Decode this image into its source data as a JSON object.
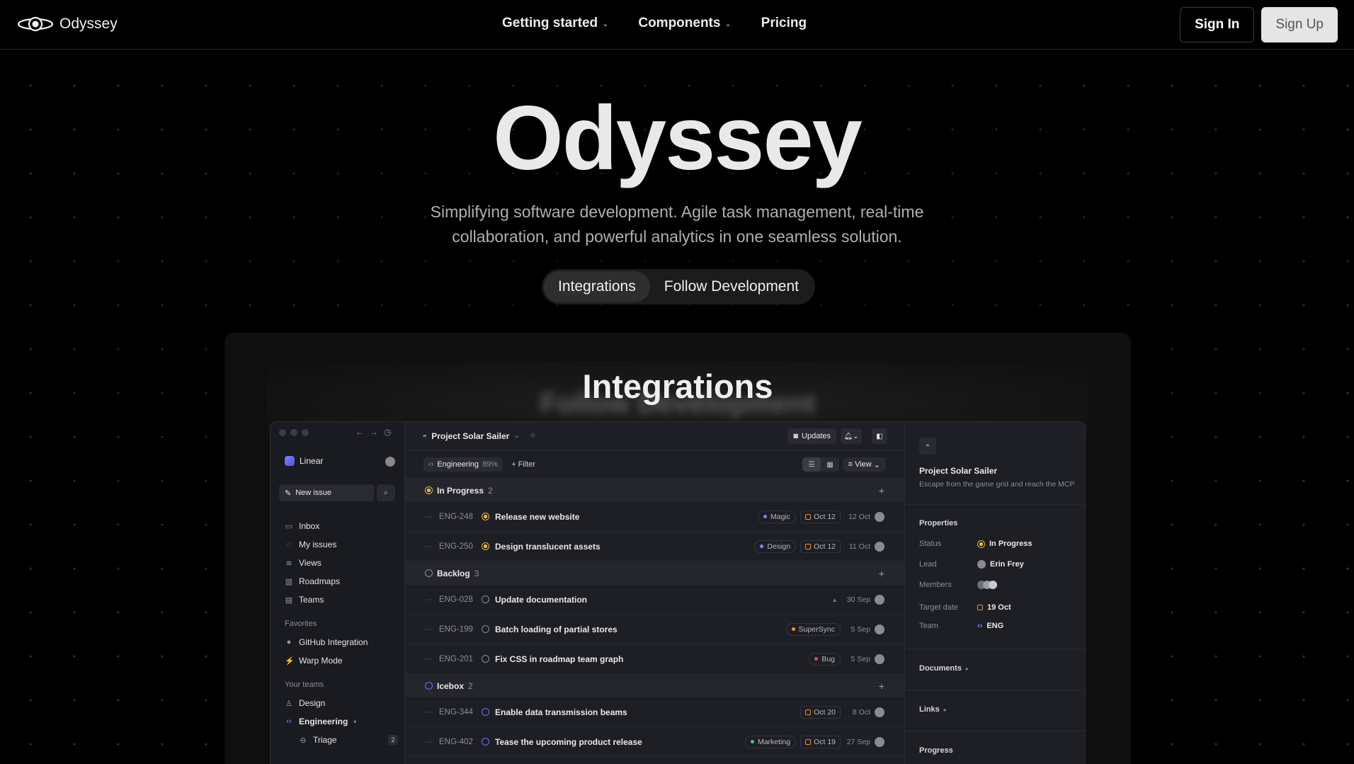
{
  "brand": {
    "name": "Odyssey",
    "logo_icon": "eye-planet-logo-icon"
  },
  "nav": {
    "links": [
      {
        "label": "Getting started",
        "has_dropdown": true
      },
      {
        "label": "Components",
        "has_dropdown": true
      },
      {
        "label": "Pricing",
        "has_dropdown": false
      }
    ],
    "sign_in": "Sign In",
    "sign_up": "Sign Up"
  },
  "hero": {
    "title": "Odyssey",
    "subtitle_line1": "Simplifying software development. Agile task management, real-time",
    "subtitle_line2": "collaboration, and powerful analytics in one seamless solution.",
    "tabs": [
      {
        "label": "Integrations",
        "active": true
      },
      {
        "label": "Follow Development",
        "active": false
      }
    ]
  },
  "showcase": {
    "title": "Integrations",
    "ghost_title": "Follow Development"
  },
  "app": {
    "workspace": "Linear",
    "new_issue": "New issue",
    "nav_items": [
      "Inbox",
      "My issues",
      "Views",
      "Roadmaps",
      "Teams"
    ],
    "favorites_label": "Favorites",
    "favorites": [
      "GitHub Integration",
      "Warp Mode"
    ],
    "teams_label": "Your teams",
    "teams": [
      {
        "label": "Design"
      },
      {
        "label": "Engineering",
        "suffix": "▾"
      },
      {
        "label": "Triage",
        "count": "2"
      }
    ],
    "project_title": "Project Solar Sailer",
    "updates": "Updates",
    "filter_chip": {
      "label": "Engineering",
      "pct": "89%"
    },
    "filter": "Filter",
    "view": "View",
    "groups": [
      {
        "label": "In Progress",
        "count": "2",
        "status": "progress",
        "issues": [
          {
            "id": "ENG-248",
            "title": "Release new website",
            "tag": "Magic",
            "tag_color": "#7c83ff",
            "due": "Oct 12",
            "date": "12 Oct"
          },
          {
            "id": "ENG-250",
            "title": "Design translucent assets",
            "tag": "Design",
            "tag_color": "#7c83ff",
            "due": "Oct 12",
            "date": "11 Oct"
          }
        ]
      },
      {
        "label": "Backlog",
        "count": "3",
        "status": "backlog",
        "issues": [
          {
            "id": "ENG-028",
            "title": "Update documentation",
            "tag": "",
            "tag_color": "",
            "due": "",
            "date": "30 Sep"
          },
          {
            "id": "ENG-199",
            "title": "Batch loading of partial stores",
            "tag": "SuperSync",
            "tag_color": "#e6923a",
            "due": "",
            "date": "5 Sep"
          },
          {
            "id": "ENG-201",
            "title": "Fix CSS in roadmap team graph",
            "tag": "Bug",
            "tag_color": "#e5484d",
            "due": "",
            "date": "5 Sep"
          }
        ]
      },
      {
        "label": "Icebox",
        "count": "2",
        "status": "icebox",
        "issues": [
          {
            "id": "ENG-344",
            "title": "Enable data transmission beams",
            "tag": "",
            "tag_color": "",
            "due": "Oct 20",
            "date": "8 Oct"
          },
          {
            "id": "ENG-402",
            "title": "Tease the upcoming product release",
            "tag": "Marketing",
            "tag_color": "#4cc38a",
            "due": "Oct 19",
            "date": "27 Sep"
          }
        ]
      }
    ],
    "details": {
      "name": "Project Solar Sailer",
      "description": "Escape from the game grid and reach the MCP",
      "properties_label": "Properties",
      "properties": [
        {
          "key": "Status",
          "value": "In Progress"
        },
        {
          "key": "Lead",
          "value": "Erin Frey"
        },
        {
          "key": "Members",
          "value": ""
        },
        {
          "key": "Target date",
          "value": "19 Oct"
        },
        {
          "key": "Team",
          "value": "ENG"
        }
      ],
      "documents": "Documents",
      "links": "Links",
      "progress": "Progress"
    }
  },
  "colors": {
    "background": "#000000",
    "accent": "#7c83ff",
    "in_progress": "#e7b53c",
    "icebox": "#6a72f2"
  }
}
